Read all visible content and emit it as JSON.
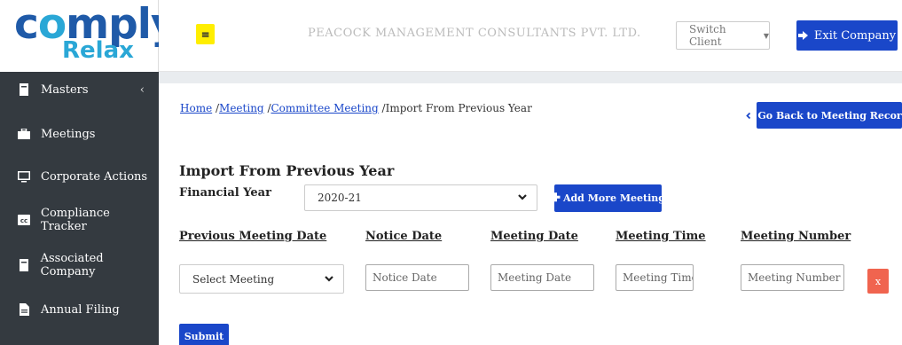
{
  "logo": {
    "main_prefix": "c",
    "main_o": "o",
    "main_suffix": "mply",
    "sub": "Relax"
  },
  "sidebar": {
    "items": [
      {
        "label": "Masters",
        "icon": "book-icon"
      },
      {
        "label": "Meetings",
        "icon": "briefcase-icon"
      },
      {
        "label": "Corporate Actions",
        "icon": "monitor-icon"
      },
      {
        "label": "Compliance Tracker",
        "icon": "cc-icon"
      },
      {
        "label": "Associated Company",
        "icon": "book-icon"
      },
      {
        "label": "Annual Filing",
        "icon": "file-icon"
      }
    ],
    "masters_chevron": "‹"
  },
  "topbar": {
    "menu_icon": "≡",
    "company_name": "PEACOCK MANAGEMENT CONSULTANTS PVT. LTD.",
    "switch_client": "Switch Client",
    "exit_label": "Exit Company"
  },
  "breadcrumb": {
    "home": "Home",
    "meeting": "Meeting",
    "committee": "Committee Meeting",
    "current": "Import From Previous Year",
    "sep": "/"
  },
  "goback_label": "Go Back to Meeting Records",
  "form": {
    "title": "Import From Previous Year",
    "fy_label": "Financial Year",
    "fy_value": "2020-21",
    "add_label": "Add More Meeting",
    "columns": [
      "Previous Meeting Date",
      "Notice Date",
      "Meeting Date",
      "Meeting Time",
      "Meeting Number"
    ],
    "select_meeting": "Select Meeting",
    "placeholders": {
      "notice": "Notice Date",
      "meeting_date": "Meeting Date",
      "meeting_time": "Meeting Time",
      "meeting_number": "Meeting Number"
    },
    "remove_label": "x",
    "submit_label": "Submit"
  },
  "colors": {
    "primary": "#1a47c9",
    "sidebar": "#343a40",
    "danger": "#f0644f",
    "menu": "#ffee00"
  }
}
